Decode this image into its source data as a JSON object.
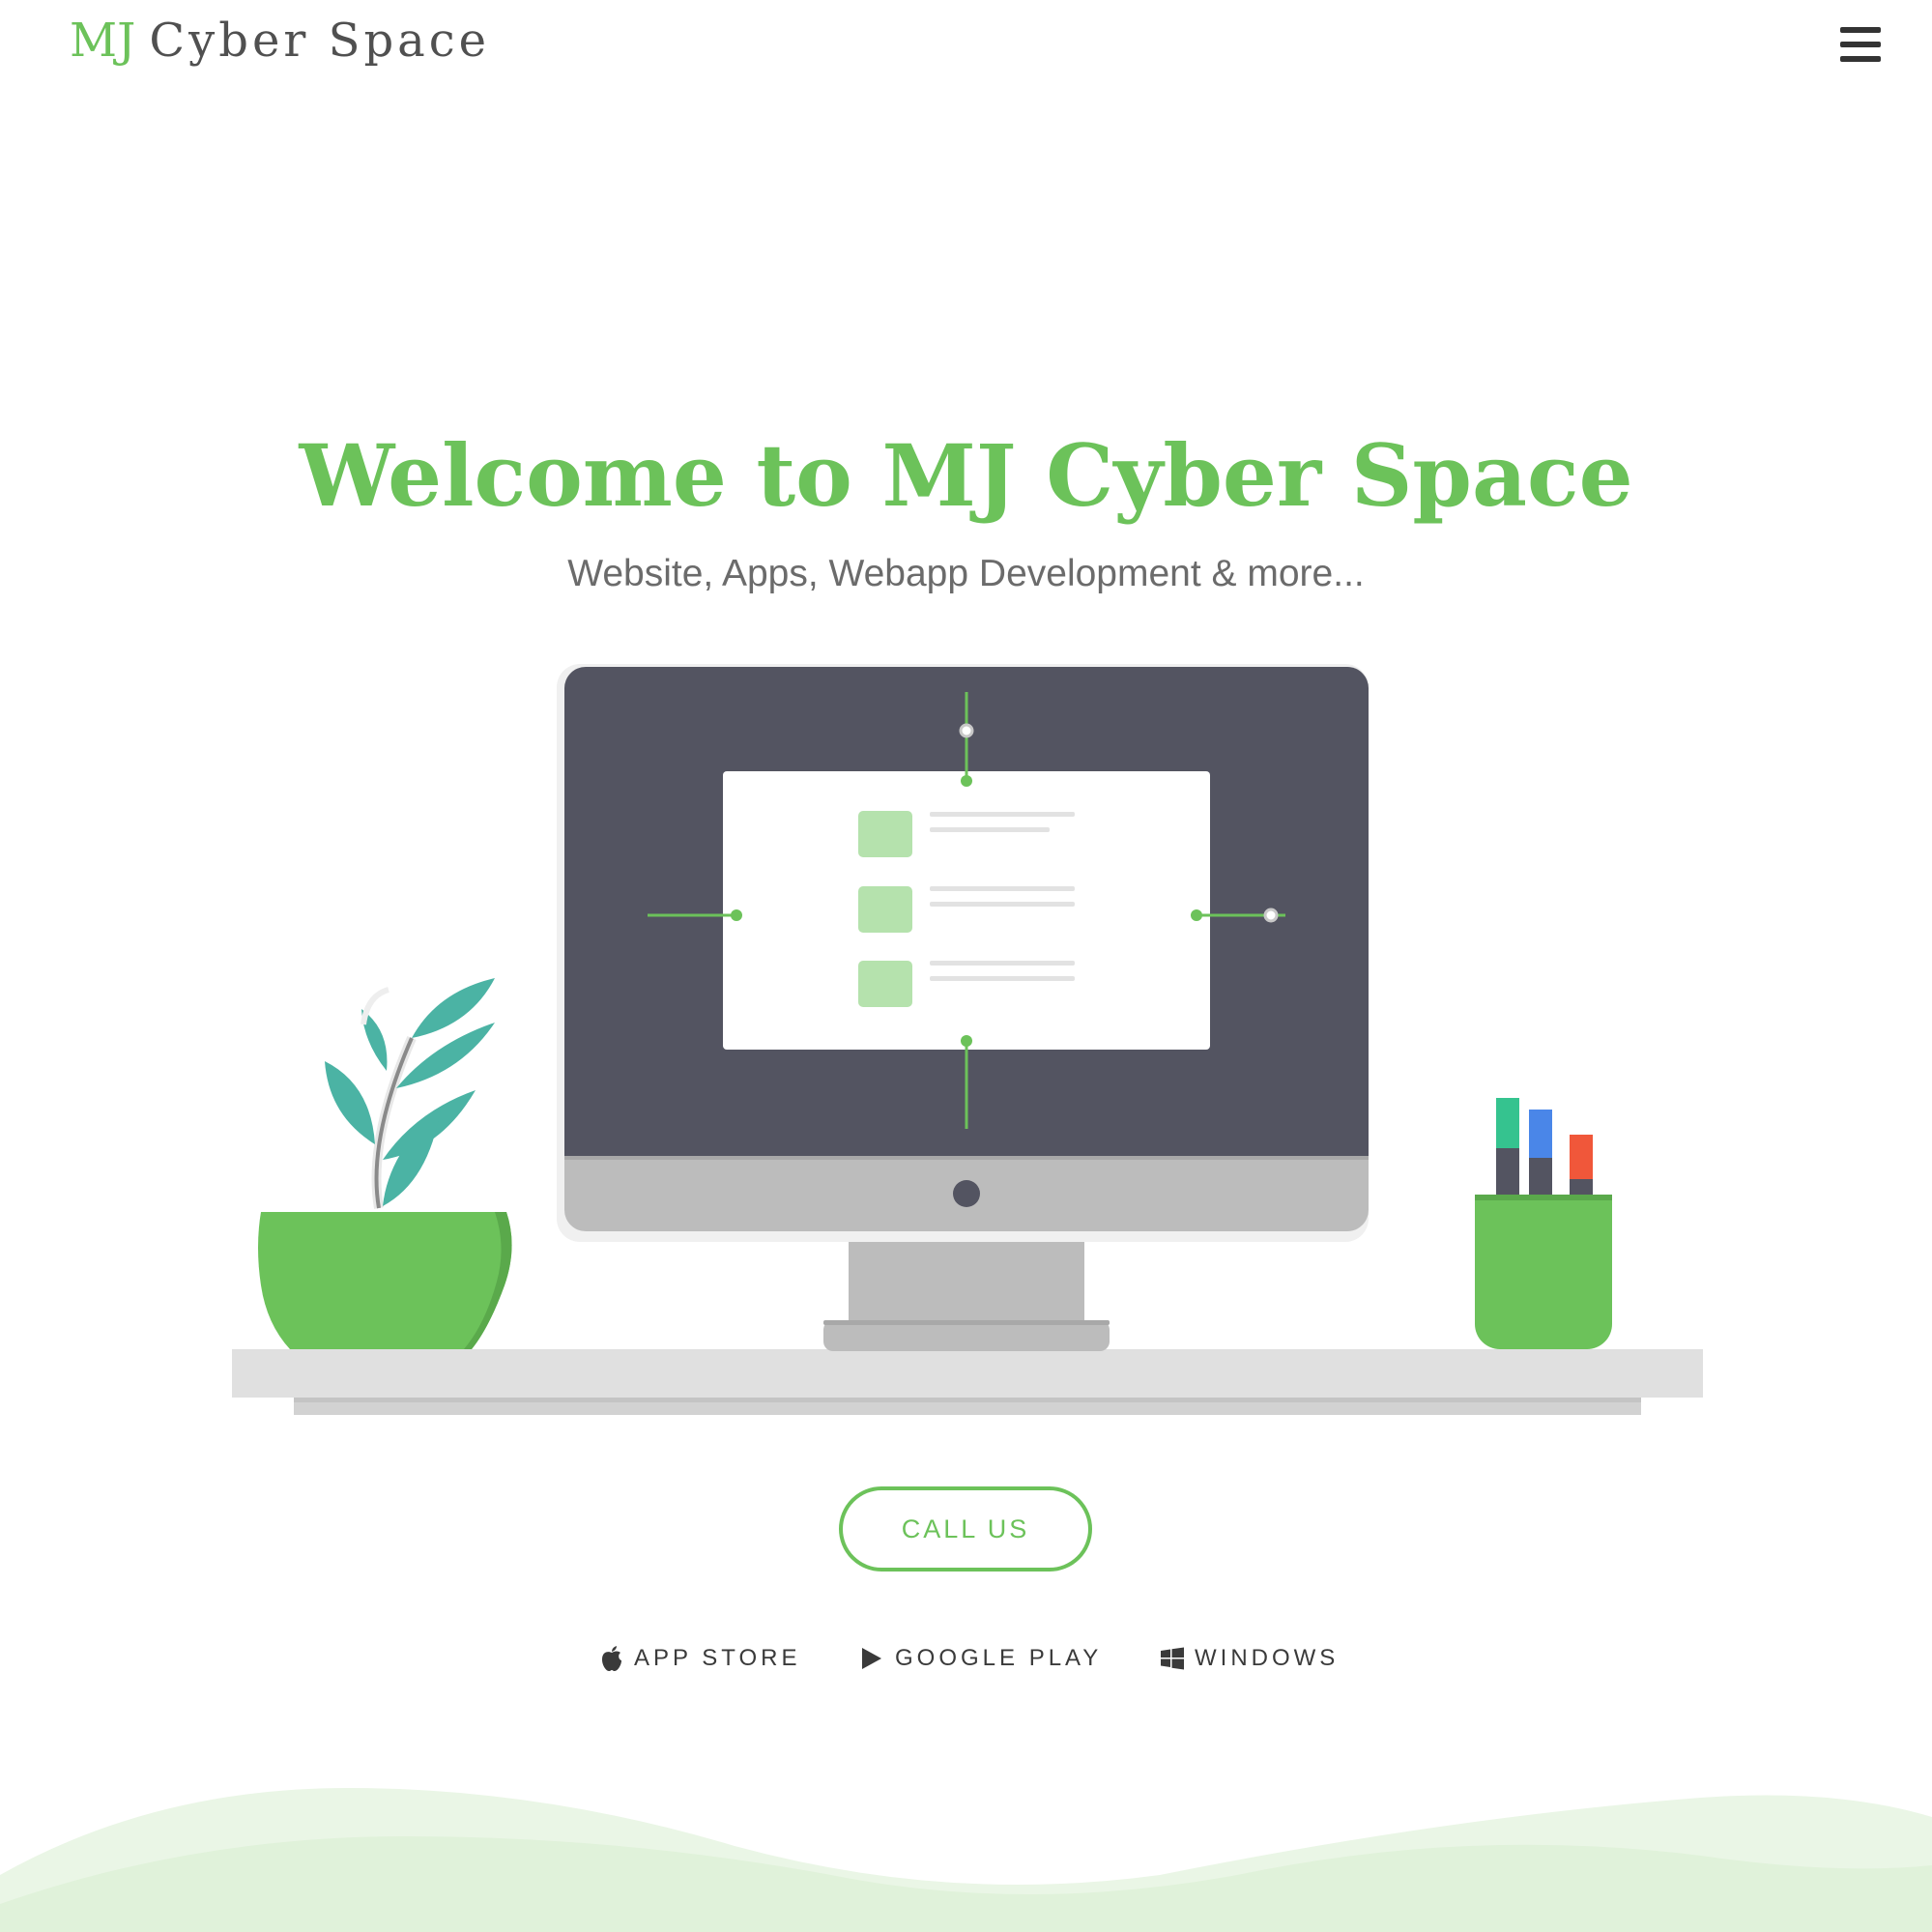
{
  "header": {
    "brand_initials": "MJ",
    "brand_name": "Cyber Space",
    "menu_icon": "hamburger-menu-icon"
  },
  "hero": {
    "title": "Welcome to MJ Cyber Space",
    "subtitle": "Website, Apps, Webapp Development & more..."
  },
  "cta": {
    "call_label": "CALL US"
  },
  "stores": [
    {
      "label": "APP STORE",
      "icon": "apple-icon"
    },
    {
      "label": "GOOGLE PLAY",
      "icon": "play-icon"
    },
    {
      "label": "WINDOWS",
      "icon": "windows-icon"
    }
  ],
  "colors": {
    "accent": "#6cc25a",
    "monitor_screen": "#535461",
    "monitor_bezel": "#bcbcbc",
    "leaf": "#4bb3a4",
    "text_dark": "#333333",
    "text_muted": "#6b6b6b"
  }
}
